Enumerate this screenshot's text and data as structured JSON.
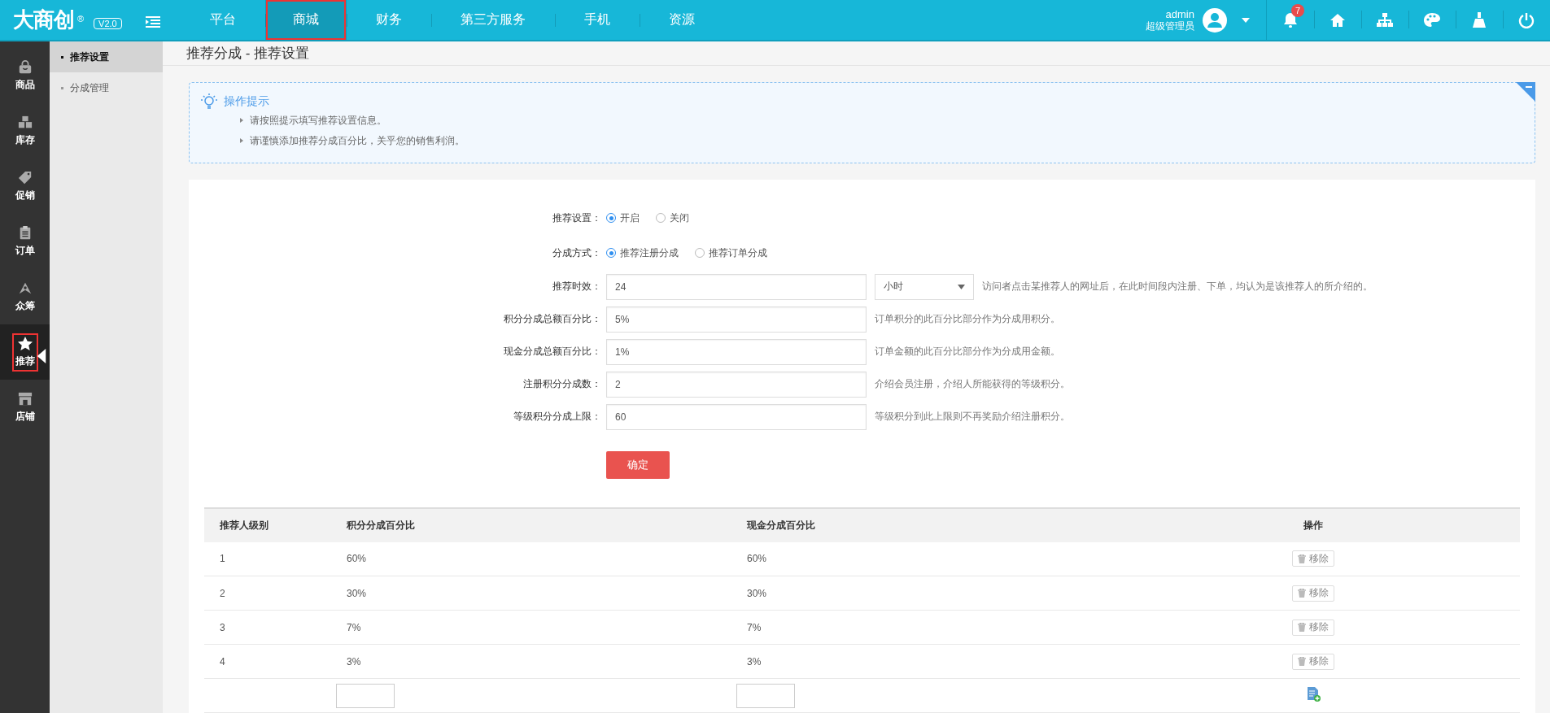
{
  "logo": {
    "text": "大商创",
    "mark": "®",
    "version": "V2.0"
  },
  "top_nav": [
    {
      "label": "平台",
      "selected": false
    },
    {
      "label": "商城",
      "selected": true
    },
    {
      "label": "财务",
      "selected": false
    },
    {
      "label": "第三方服务",
      "selected": false
    },
    {
      "label": "手机",
      "selected": false
    },
    {
      "label": "资源",
      "selected": false
    }
  ],
  "user": {
    "name": "admin",
    "role": "超级管理员"
  },
  "notifications": {
    "count": "7"
  },
  "toolbar": [
    {
      "kind": "home"
    },
    {
      "kind": "sitemap"
    },
    {
      "kind": "palette"
    },
    {
      "kind": "broom"
    },
    {
      "kind": "power"
    }
  ],
  "sidebar": {
    "items": [
      {
        "label": "商品",
        "kind": "bag",
        "selected": false
      },
      {
        "label": "库存",
        "kind": "cubes",
        "selected": false
      },
      {
        "label": "促销",
        "kind": "tag",
        "selected": false
      },
      {
        "label": "订单",
        "kind": "clipboard",
        "selected": false
      },
      {
        "label": "众筹",
        "kind": "rocket",
        "selected": false
      },
      {
        "label": "推荐",
        "kind": "star",
        "selected": true
      },
      {
        "label": "店铺",
        "kind": "store",
        "selected": false
      }
    ]
  },
  "subnav": {
    "items": [
      {
        "label": "推荐设置",
        "selected": true
      },
      {
        "label": "分成管理",
        "selected": false
      }
    ]
  },
  "page_title": "推荐分成 - 推荐设置",
  "tips": {
    "title": "操作提示",
    "items": [
      "请按照提示填写推荐设置信息。",
      "请谨慎添加推荐分成百分比，关乎您的销售利润。"
    ]
  },
  "form": {
    "rows": [
      {
        "kind": "radio",
        "label": "推荐设置：",
        "options": [
          {
            "label": "开启",
            "selected": true
          },
          {
            "label": "关闭",
            "selected": false
          }
        ]
      },
      {
        "kind": "radio",
        "label": "分成方式：",
        "options": [
          {
            "label": "推荐注册分成",
            "selected": true
          },
          {
            "label": "推荐订单分成",
            "selected": false
          }
        ]
      },
      {
        "kind": "input",
        "label": "推荐时效：",
        "value": "24",
        "select": "小时",
        "hint": "访问者点击某推荐人的网址后，在此时间段内注册、下单，均认为是该推荐人的所介绍的。"
      },
      {
        "kind": "input",
        "label": "积分分成总额百分比：",
        "value": "5%",
        "hint": "订单积分的此百分比部分作为分成用积分。"
      },
      {
        "kind": "input",
        "label": "现金分成总额百分比：",
        "value": "1%",
        "hint": "订单金额的此百分比部分作为分成用金额。"
      },
      {
        "kind": "input",
        "label": "注册积分分成数：",
        "value": "2",
        "hint": "介绍会员注册，介绍人所能获得的等级积分。"
      },
      {
        "kind": "input",
        "label": "等级积分分成上限：",
        "value": "60",
        "hint": "等级积分到此上限则不再奖励介绍注册积分。"
      }
    ],
    "submit": "确定"
  },
  "table": {
    "columns": [
      "推荐人级别",
      "积分分成百分比",
      "现金分成百分比",
      "操作"
    ],
    "rows": [
      {
        "cells": [
          "1",
          "60%",
          "60%"
        ],
        "action": "移除"
      },
      {
        "cells": [
          "2",
          "30%",
          "30%"
        ],
        "action": "移除"
      },
      {
        "cells": [
          "3",
          "7%",
          "7%"
        ],
        "action": "移除"
      },
      {
        "cells": [
          "4",
          "3%",
          "3%"
        ],
        "action": "移除"
      }
    ]
  }
}
